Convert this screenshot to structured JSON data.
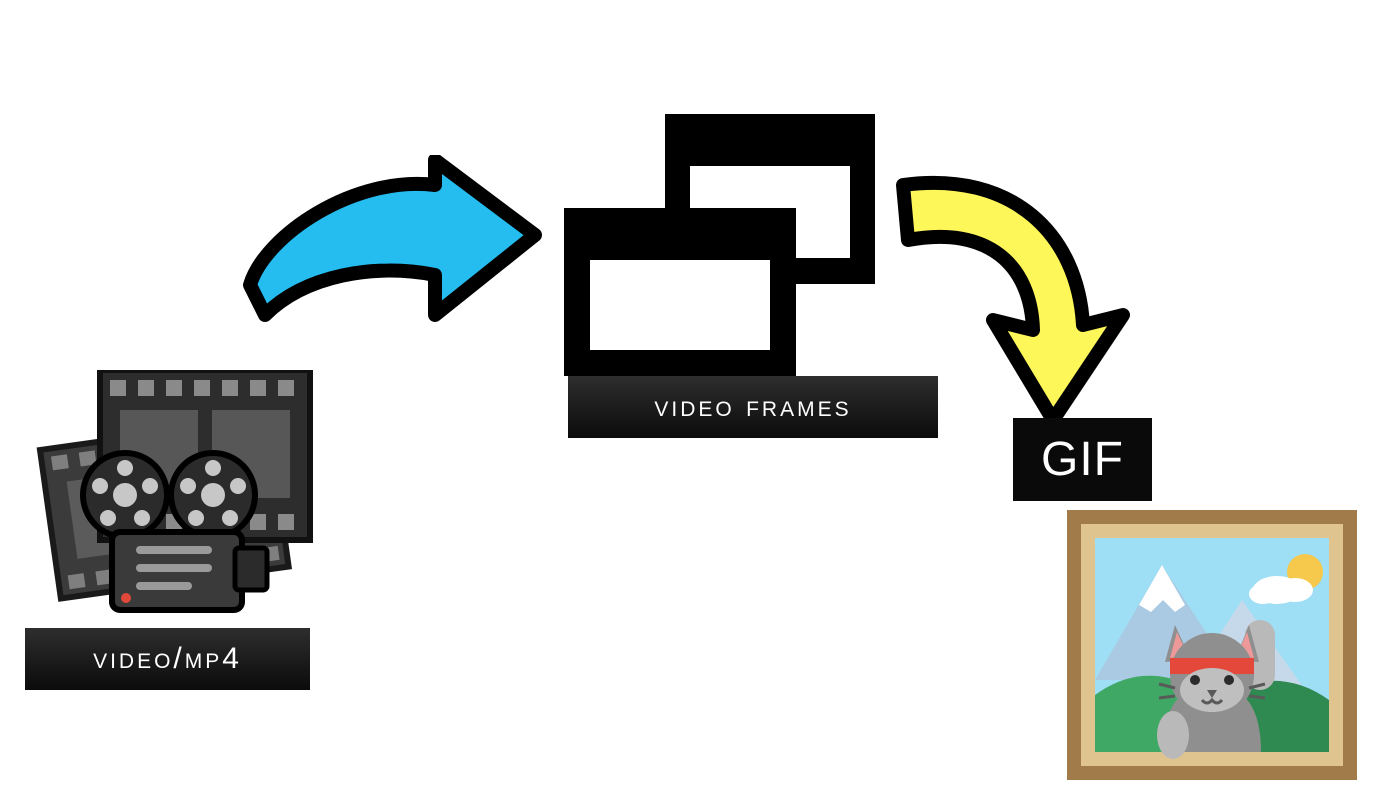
{
  "diagram": {
    "stage1": {
      "label": "video/mp4",
      "icon_name": "video-camera-and-film-icon"
    },
    "arrow1": {
      "icon_name": "right-arrow-icon",
      "fill": "#25bcf0",
      "stroke": "#000000"
    },
    "stage2": {
      "label": "video frames",
      "icon_name": "overlapping-windows-icon"
    },
    "arrow2": {
      "icon_name": "curved-down-arrow-icon",
      "fill": "#fdf75a",
      "stroke": "#000000"
    },
    "stage3": {
      "label": "GIF",
      "icon_name": "framed-cat-picture-icon"
    },
    "colors": {
      "label_bg": "#121212",
      "label_fg": "#ffffff",
      "arrow1_fill": "#25bcf0",
      "arrow2_fill": "#fdf75a",
      "picture_frame": "#a17b49",
      "picture_inner": "#e0c48f",
      "sky": "#9edff5",
      "mountain": "#aac9e2",
      "hill": "#3fa864",
      "sun": "#f6c84c",
      "cloud": "#ffffff",
      "cat_body": "#8f8f8f",
      "cat_face": "#bfbfbf",
      "cat_headband": "#e4483b"
    }
  }
}
